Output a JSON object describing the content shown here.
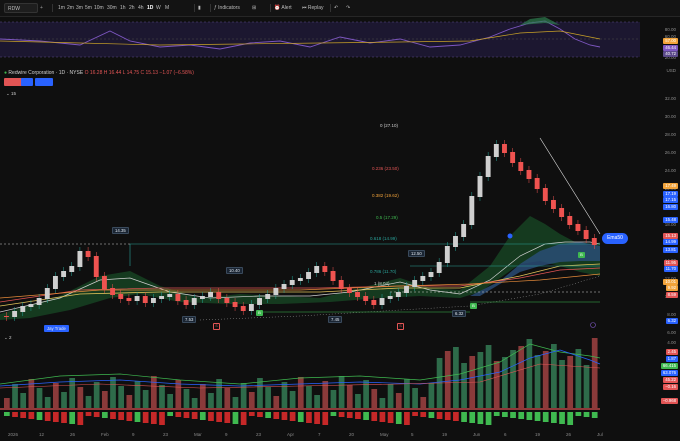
{
  "toolbar": {
    "symbol": "RDW",
    "intervals": [
      "1m",
      "2m",
      "3m",
      "5m",
      "10m",
      "30m",
      "1h",
      "2h",
      "4h",
      "1D",
      "W",
      "M"
    ],
    "active_interval": "1D",
    "indicators_label": "Indicators",
    "alert_label": "Alert",
    "replay_label": "Replay"
  },
  "legend": {
    "name": "Redwire Corporation · 1D · NYSE",
    "ohlc": "O 16.28  H 16.44  L 14.75  C 15.13  −1.07 (−6.58%)",
    "sub_count": "15"
  },
  "rsi": {
    "axis": [
      "80.00",
      "60.00",
      "40.00",
      "20.00"
    ],
    "tags": [
      "57.00",
      "46.44",
      "40.72"
    ]
  },
  "main": {
    "axis": [
      "32.00",
      "30.00",
      "28.00",
      "26.00",
      "24.00",
      "22.00",
      "20.00",
      "18.00",
      "16.00",
      "14.00",
      "12.00",
      "10.00",
      "8.00",
      "6.00",
      "4.00"
    ],
    "usd_label": "USD",
    "fib_labels": [
      "0 (27.10)",
      "0.236 (23.50)",
      "0.382 (19.62)",
      "0.5 (17.29)",
      "0.618 (14.99)",
      "0.786 (11.70)",
      "1 (8.04)"
    ],
    "box_labels": [
      "14.35",
      "10.40",
      "7.53",
      "7.45",
      "12.50",
      "6.32"
    ],
    "indicator_pill": "Ema50",
    "label_ticker": "Jay Trade",
    "price_tags": [
      {
        "v": "17.49",
        "c": "#f2a33a"
      },
      {
        "v": "17.19",
        "c": "#2962ff"
      },
      {
        "v": "17.15",
        "c": "#2962ff"
      },
      {
        "v": "16.80",
        "c": "#2962ff"
      },
      {
        "v": "15.48",
        "c": "#2962ff"
      },
      {
        "v": "15.13",
        "c": "#e25555"
      },
      {
        "v": "14.99",
        "c": "#2962ff"
      },
      {
        "v": "13.81",
        "c": "#2962ff"
      },
      {
        "v": "11.95",
        "c": "#e25555"
      },
      {
        "v": "11.70",
        "c": "#2962ff"
      },
      {
        "v": "10.01",
        "c": "#f2a33a"
      },
      {
        "v": "9.92",
        "c": "#f2a33a"
      },
      {
        "v": "8.59",
        "c": "#e25555"
      },
      {
        "v": "6.32",
        "c": "#2962ff"
      }
    ]
  },
  "lower": {
    "count_label": "2",
    "tags": [
      {
        "v": "2.45",
        "c": "#e25555"
      },
      {
        "v": "1.87",
        "c": "#2962ff"
      },
      {
        "v": "66.415",
        "c": "#3fb950"
      },
      {
        "v": "63.076",
        "c": "#2962ff"
      },
      {
        "v": "45.22",
        "c": "#e25555"
      },
      {
        "v": "−0.16",
        "c": "#e25555"
      },
      {
        "v": "−0.968",
        "c": "#e25555"
      }
    ],
    "left_val": "4.00"
  },
  "dates": [
    "2026",
    "12",
    "26",
    "Feb",
    "9",
    "23",
    "Mar",
    "9",
    "23",
    "Apr",
    "7",
    "20",
    "May",
    "5",
    "19",
    "Jun",
    "6",
    "19",
    "26",
    "Jul"
  ]
}
